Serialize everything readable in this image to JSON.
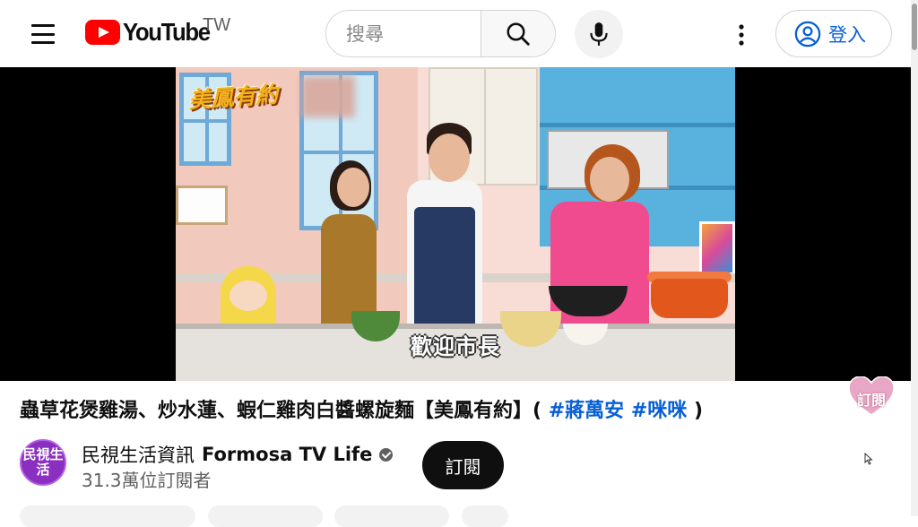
{
  "header": {
    "logo_text": "YouTube",
    "country_code": "TW",
    "search_placeholder": "搜尋",
    "signin_label": "登入"
  },
  "video": {
    "show_logo": "美鳳有約",
    "subtitle": "歡迎市長",
    "subscribe_watermark": "訂閱"
  },
  "title": {
    "text": "蟲草花煲雞湯、炒水蓮、蝦仁雞肉白醬螺旋麵【美鳳有約】(",
    "hashtags": [
      "#蔣萬安",
      "#咪咪"
    ],
    "close": ")"
  },
  "channel": {
    "avatar_text": "民視生活",
    "name_cn": "民視生活資訊",
    "name_en": "Formosa TV Life",
    "subscribers": "31.3萬位訂閱者",
    "subscribe_label": "訂閱"
  },
  "colors": {
    "brand_red": "#ff0000",
    "link_blue": "#065fd4",
    "avatar_purple": "#8a2fbf"
  },
  "icons": [
    "menu-icon",
    "youtube-logo-icon",
    "search-icon",
    "mic-icon",
    "more-vert-icon",
    "account-circle-icon",
    "verified-badge-icon"
  ]
}
